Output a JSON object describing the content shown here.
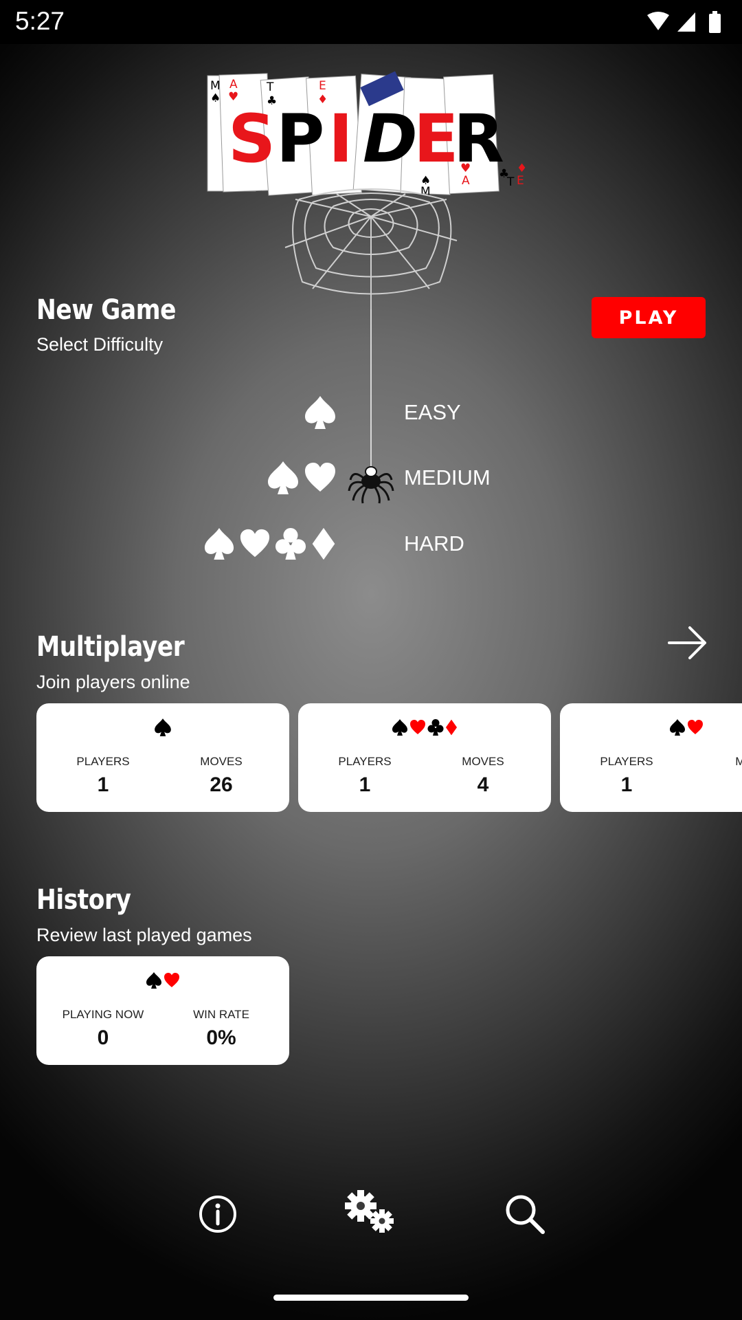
{
  "status_bar": {
    "time": "5:27"
  },
  "logo": {
    "letters": [
      "S",
      "P",
      "I",
      "D",
      "E",
      "R"
    ],
    "card_corners": [
      "M",
      "A",
      "T",
      "E",
      "M",
      "A",
      "T",
      "E"
    ]
  },
  "new_game": {
    "title": "New Game",
    "subtitle": "Select Difficulty",
    "play_label": "PLAY",
    "difficulties": [
      {
        "label": "EASY",
        "suits": [
          "spade"
        ]
      },
      {
        "label": "MEDIUM",
        "suits": [
          "spade",
          "heart"
        ]
      },
      {
        "label": "HARD",
        "suits": [
          "spade",
          "heart",
          "club",
          "diamond"
        ]
      }
    ]
  },
  "multiplayer": {
    "title": "Multiplayer",
    "subtitle": "Join players online",
    "cards": [
      {
        "suits": [
          "spade"
        ],
        "stats": [
          {
            "label": "PLAYERS",
            "value": "1"
          },
          {
            "label": "MOVES",
            "value": "26"
          }
        ]
      },
      {
        "suits": [
          "spade",
          "heart",
          "club",
          "diamond"
        ],
        "stats": [
          {
            "label": "PLAYERS",
            "value": "1"
          },
          {
            "label": "MOVES",
            "value": "4"
          }
        ]
      },
      {
        "suits": [
          "spade",
          "heart"
        ],
        "stats": [
          {
            "label": "PLAYERS",
            "value": "1"
          },
          {
            "label": "MO",
            "value": ""
          }
        ]
      }
    ]
  },
  "history": {
    "title": "History",
    "subtitle": "Review last played games",
    "cards": [
      {
        "suits": [
          "spade",
          "heart"
        ],
        "stats": [
          {
            "label": "PLAYING NOW",
            "value": "0"
          },
          {
            "label": "WIN RATE",
            "value": "0%"
          }
        ]
      }
    ]
  },
  "bottom_nav": {
    "icons": [
      "info-icon",
      "gear-icon",
      "search-icon"
    ]
  },
  "colors": {
    "accent_red": "#ff0000",
    "suit_red": "#ff0000",
    "suit_black": "#000000",
    "card_bg": "#ffffff"
  }
}
